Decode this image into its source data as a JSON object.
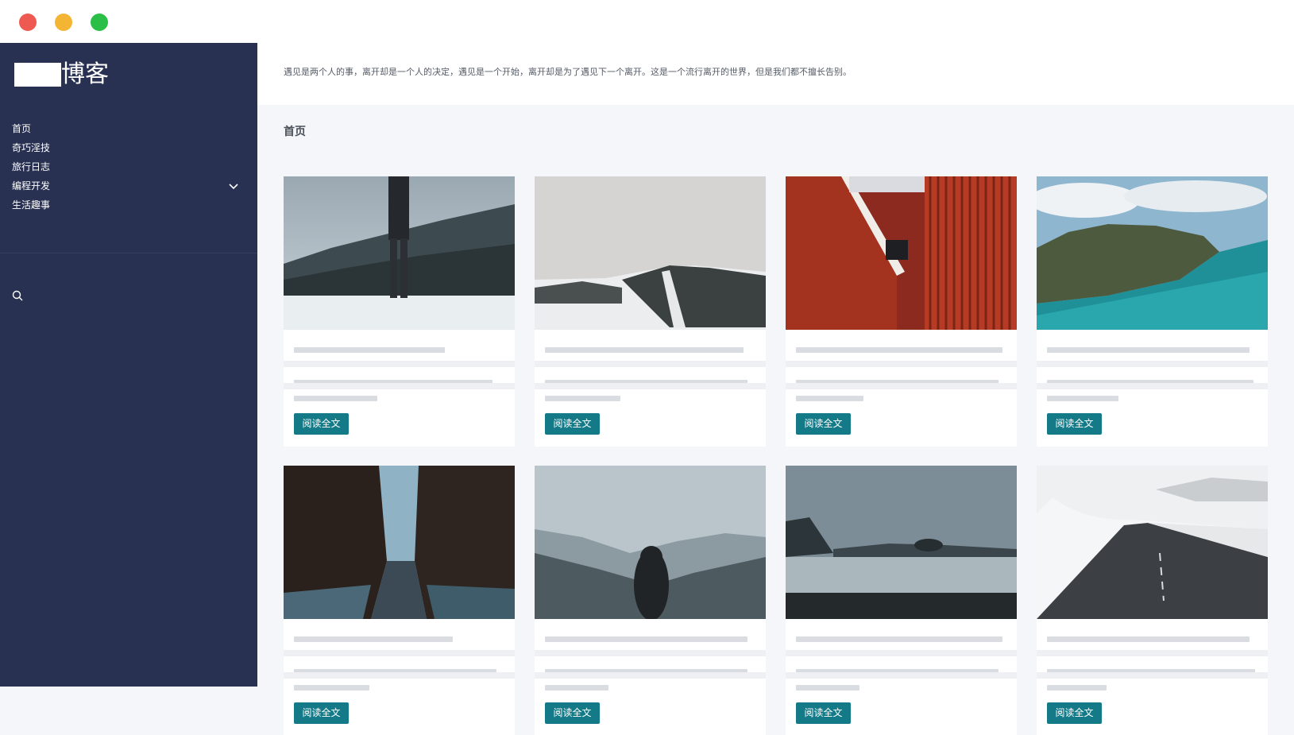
{
  "sidebar": {
    "logo_text": "博客",
    "nav": [
      {
        "label": "首页"
      },
      {
        "label": "奇巧淫技"
      },
      {
        "label": "旅行日志"
      },
      {
        "label": "编程开发"
      },
      {
        "label": "生活趣事"
      }
    ]
  },
  "header": {
    "quote": "遇见是两个人的事，离开却是一个人的决定，遇见是一个开始，离开却是为了遇见下一个离开。这是一个流行离开的世界，但是我们都不擅长告别。"
  },
  "main": {
    "page_title": "首页",
    "read_more_label": "阅读全文",
    "cards": [
      {
        "image": "hiker-snowy-forest"
      },
      {
        "image": "snowy-mountain-ski-slope"
      },
      {
        "image": "red-building-facade"
      },
      {
        "image": "coastal-cliffs-turquoise-sea"
      },
      {
        "image": "city-street-winter"
      },
      {
        "image": "hooded-figure-mountain-haze"
      },
      {
        "image": "stormy-sea-rocks"
      },
      {
        "image": "snowy-road"
      }
    ]
  },
  "colors": {
    "sidebar_bg": "#283152",
    "button_bg": "#147a87",
    "page_bg": "#f4f6fa"
  },
  "icons": [
    "search-icon",
    "chevron-down-icon"
  ]
}
